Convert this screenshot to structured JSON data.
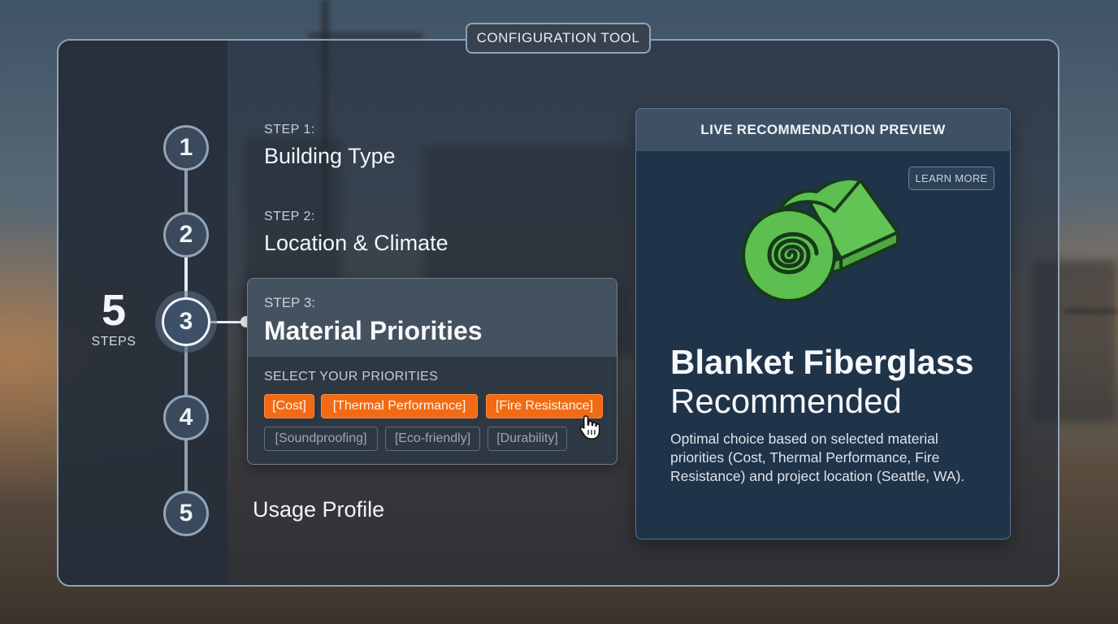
{
  "tool_label": "CONFIGURATION TOOL",
  "steps_count": {
    "number": "5",
    "word": "STEPS"
  },
  "steps": [
    {
      "number": "1",
      "kicker": "STEP 1:",
      "title": "Building Type"
    },
    {
      "number": "2",
      "kicker": "STEP 2:",
      "title": "Location & Climate"
    },
    {
      "number": "3",
      "kicker": "STEP 3:",
      "title": "Material Priorities"
    },
    {
      "number": "4"
    },
    {
      "number": "5",
      "title": "Usage Profile"
    }
  ],
  "priorities": {
    "label": "SELECT YOUR PRIORITIES",
    "chips": [
      {
        "label": "[Cost]",
        "selected": true
      },
      {
        "label": "[Thermal Performance]",
        "selected": true
      },
      {
        "label": "[Fire Resistance]",
        "selected": true
      },
      {
        "label": "[Soundproofing]",
        "selected": false
      },
      {
        "label": "[Eco-friendly]",
        "selected": false
      },
      {
        "label": "[Durability]",
        "selected": false
      }
    ]
  },
  "preview": {
    "header": "LIVE RECOMMENDATION PREVIEW",
    "learn_more": "LEARN MORE",
    "icon": "insulation-roll-icon",
    "recommendation_name": "Blanket Fiberglass",
    "recommendation_word": "Recommended",
    "description": "Optimal choice based on selected material priorities (Cost, Thermal Performance, Fire Resistance) and project location (Seattle, WA)."
  },
  "colors": {
    "accent_orange": "#f26a13",
    "roll_green": "#5cbf4f",
    "panel_navy": "#1f3349"
  }
}
